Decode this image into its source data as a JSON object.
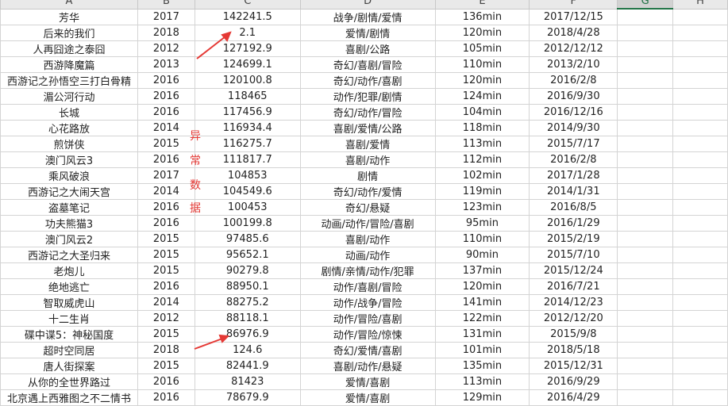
{
  "columns": [
    "A",
    "B",
    "C",
    "D",
    "E",
    "F",
    "G",
    "H"
  ],
  "rows": [
    [
      "芳华",
      "2017",
      "142241.5",
      "战争/剧情/爱情",
      "136min",
      "2017/12/15"
    ],
    [
      "后来的我们",
      "2018",
      "2.1",
      "爱情/剧情",
      "120min",
      "2018/4/28"
    ],
    [
      "人再囧途之泰囧",
      "2012",
      "127192.9",
      "喜剧/公路",
      "105min",
      "2012/12/12"
    ],
    [
      "西游降魔篇",
      "2013",
      "124699.1",
      "奇幻/喜剧/冒险",
      "110min",
      "2013/2/10"
    ],
    [
      "西游记之孙悟空三打白骨精",
      "2016",
      "120100.8",
      "奇幻/动作/喜剧",
      "120min",
      "2016/2/8"
    ],
    [
      "湄公河行动",
      "2016",
      "118465",
      "动作/犯罪/剧情",
      "124min",
      "2016/9/30"
    ],
    [
      "长城",
      "2016",
      "117456.9",
      "奇幻/动作/冒险",
      "104min",
      "2016/12/16"
    ],
    [
      "心花路放",
      "2014",
      "116934.4",
      "喜剧/爱情/公路",
      "118min",
      "2014/9/30"
    ],
    [
      "煎饼侠",
      "2015",
      "116275.7",
      "喜剧/爱情",
      "113min",
      "2015/7/17"
    ],
    [
      "澳门风云3",
      "2016",
      "111817.7",
      "喜剧/动作",
      "112min",
      "2016/2/8"
    ],
    [
      "乘风破浪",
      "2017",
      "104853",
      "剧情",
      "102min",
      "2017/1/28"
    ],
    [
      "西游记之大闹天宫",
      "2014",
      "104549.6",
      "奇幻/动作/爱情",
      "119min",
      "2014/1/31"
    ],
    [
      "盗墓笔记",
      "2016",
      "100453",
      "奇幻/悬疑",
      "123min",
      "2016/8/5"
    ],
    [
      "功夫熊猫3",
      "2016",
      "100199.8",
      "动画/动作/冒险/喜剧",
      "95min",
      "2016/1/29"
    ],
    [
      "澳门风云2",
      "2015",
      "97485.6",
      "喜剧/动作",
      "110min",
      "2015/2/19"
    ],
    [
      "西游记之大圣归来",
      "2015",
      "95652.1",
      "动画/动作",
      "90min",
      "2015/7/10"
    ],
    [
      "老炮儿",
      "2015",
      "90279.8",
      "剧情/亲情/动作/犯罪",
      "137min",
      "2015/12/24"
    ],
    [
      "绝地逃亡",
      "2016",
      "88950.1",
      "动作/喜剧/冒险",
      "120min",
      "2016/7/21"
    ],
    [
      "智取威虎山",
      "2014",
      "88275.2",
      "动作/战争/冒险",
      "141min",
      "2014/12/23"
    ],
    [
      "十二生肖",
      "2012",
      "88118.1",
      "动作/冒险/喜剧",
      "122min",
      "2012/12/20"
    ],
    [
      "碟中谍5：神秘国度",
      "2015",
      "86976.9",
      "动作/冒险/惊悚",
      "131min",
      "2015/9/8"
    ],
    [
      "超时空同居",
      "2018",
      "124.6",
      "奇幻/爱情/喜剧",
      "101min",
      "2018/5/18"
    ],
    [
      "唐人街探案",
      "2015",
      "82441.9",
      "喜剧/动作/悬疑",
      "135min",
      "2015/12/31"
    ],
    [
      "从你的全世界路过",
      "2016",
      "81423",
      "爱情/喜剧",
      "113min",
      "2016/9/29"
    ],
    [
      "北京遇上西雅图之不二情书",
      "2016",
      "78679.9",
      "爱情/喜剧",
      "129min",
      "2016/4/29"
    ]
  ],
  "annotation": [
    "异",
    "常",
    "数",
    "据"
  ],
  "colors": {
    "annotation": "#e53935",
    "selected_header": "#217346"
  }
}
